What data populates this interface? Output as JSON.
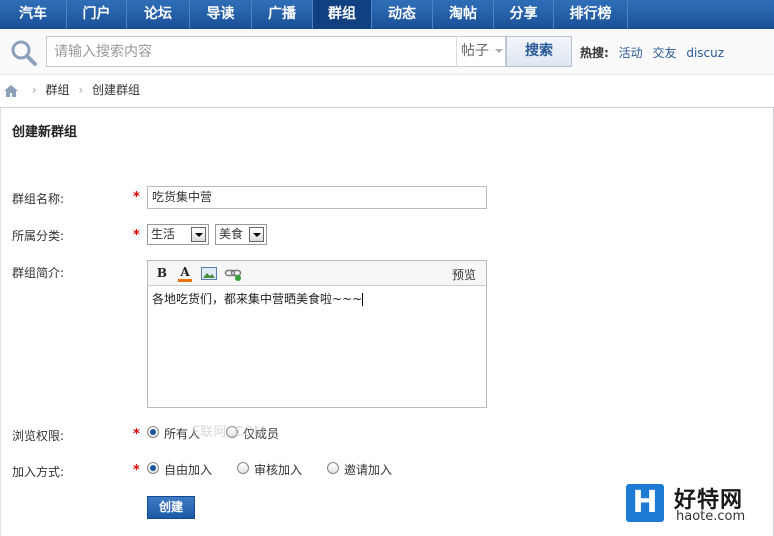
{
  "nav": {
    "items": [
      {
        "label": "汽车",
        "active": false
      },
      {
        "label": "门户",
        "active": false
      },
      {
        "label": "论坛",
        "active": false
      },
      {
        "label": "导读",
        "active": false
      },
      {
        "label": "广播",
        "active": false
      },
      {
        "label": "群组",
        "active": true
      },
      {
        "label": "动态",
        "active": false
      },
      {
        "label": "淘帖",
        "active": false
      },
      {
        "label": "分享",
        "active": false
      },
      {
        "label": "排行榜",
        "active": false
      }
    ]
  },
  "search": {
    "placeholder": "请输入搜索内容",
    "type": "帖子",
    "button": "搜索",
    "hot_label": "热搜:",
    "hot_links": [
      "活动",
      "交友",
      "discuz"
    ]
  },
  "breadcrumb": {
    "items": [
      "群组",
      "创建群组"
    ]
  },
  "form": {
    "title": "创建新群组",
    "name_label": "群组名称:",
    "name_value": "吃货集中营",
    "category_label": "所属分类:",
    "category_main": "生活",
    "category_sub": "美食",
    "intro_label": "群组简介:",
    "editor": {
      "bold": "B",
      "color": "A",
      "preview": "预览",
      "content": "各地吃货们，都来集中营晒美食啦~~~"
    },
    "view_label": "浏览权限:",
    "view_options": [
      "所有人",
      "仅成员"
    ],
    "join_label": "加入方式:",
    "join_options": [
      "自由加入",
      "审核加入",
      "邀请加入"
    ],
    "submit": "创建"
  },
  "watermark": "E联网 .COM",
  "logo": {
    "letter": "H",
    "name": "好特网",
    "url": "haote.com"
  },
  "colors": {
    "nav_bg": "#1b5199",
    "accent": "#2a5a98",
    "required": "#dd0000"
  }
}
